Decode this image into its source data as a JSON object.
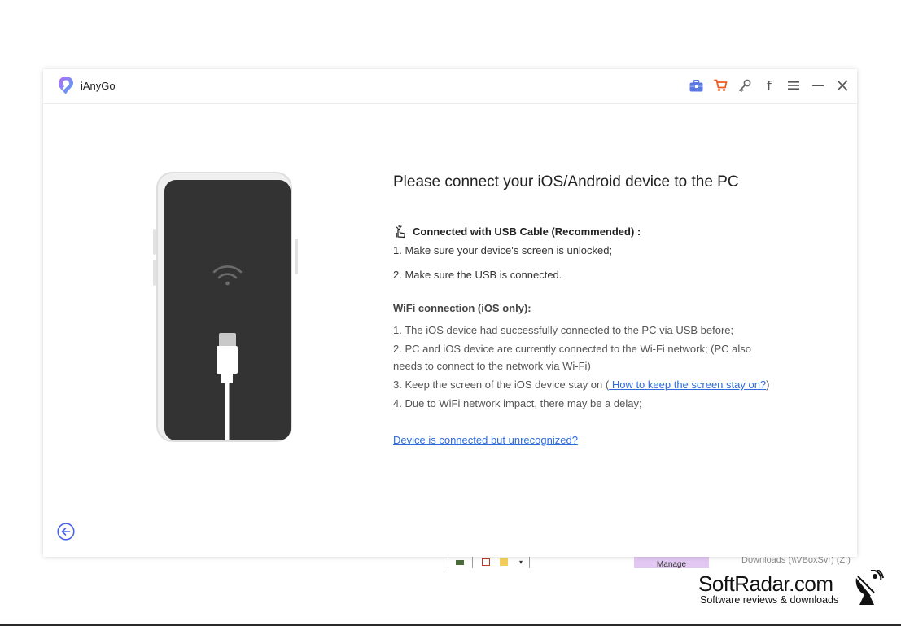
{
  "app": {
    "title": "iAnyGo"
  },
  "toolbar": {
    "icons": [
      "briefcase-icon",
      "cart-icon",
      "key-icon",
      "facebook-icon",
      "menu-icon",
      "minimize-icon",
      "close-icon"
    ],
    "facebook_glyph": "f"
  },
  "main": {
    "heading": "Please connect your iOS/Android device to the PC",
    "usb": {
      "title": "Connected with USB Cable (Recommended) :",
      "steps": [
        "1. Make sure your device's screen is unlocked;",
        "2. Make sure the USB is connected."
      ]
    },
    "wifi": {
      "title": "WiFi connection (iOS only):",
      "step1": "1. The iOS device had successfully connected to the PC via USB before;",
      "step2_line1": "2. PC and iOS device are currently connected to the Wi-Fi network; (PC also",
      "step2_line2": "needs to connect to the network via Wi-Fi)",
      "step3_prefix": "3. Keep the screen of the iOS device stay on  (",
      "step3_link": " How to keep the screen stay on?",
      "step3_suffix": ")",
      "step4": "4. Due to WiFi network impact, there may be a delay;"
    },
    "unrecognized_link": "Device is connected but unrecognized?"
  },
  "background": {
    "manage_label": "Manage",
    "downloads_label": "Downloads (\\\\VBoxSvr) (Z:)"
  },
  "watermark": {
    "title": "SoftRadar.com",
    "subtitle": "Software reviews & downloads"
  },
  "colors": {
    "accent": "#2f6bdd",
    "cart": "#f25a1d",
    "briefcase": "#5a78e0",
    "phone_screen": "#333333"
  }
}
